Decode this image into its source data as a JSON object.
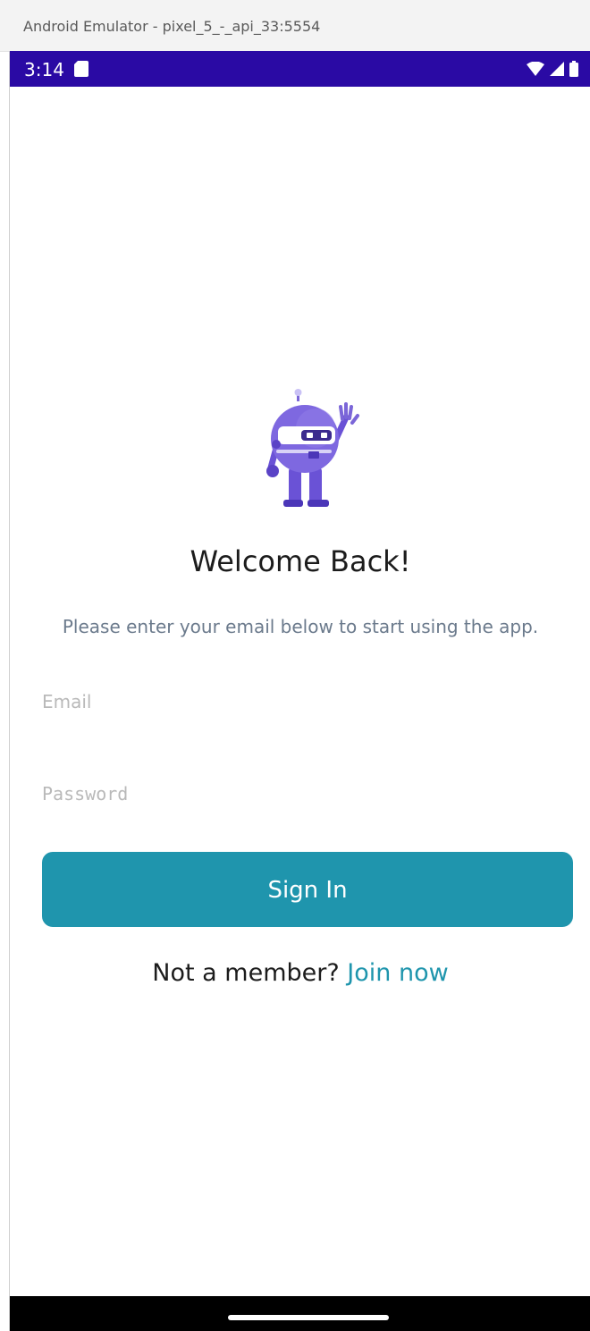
{
  "window": {
    "title": "Android Emulator - pixel_5_-_api_33:5554"
  },
  "status_bar": {
    "time": "3:14",
    "icons": [
      "sd-card-icon",
      "wifi-icon",
      "signal-icon",
      "battery-icon"
    ],
    "color": "#2a0aa4"
  },
  "login": {
    "mascot": "robot-mascot-icon",
    "title": "Welcome Back!",
    "subtitle": "Please enter your email below to start using the app.",
    "email_placeholder": "Email",
    "password_placeholder": "Password",
    "sign_in_label": "Sign In",
    "member_prompt": "Not a member?",
    "join_label": "Join now",
    "accent_color": "#1f95ad"
  }
}
